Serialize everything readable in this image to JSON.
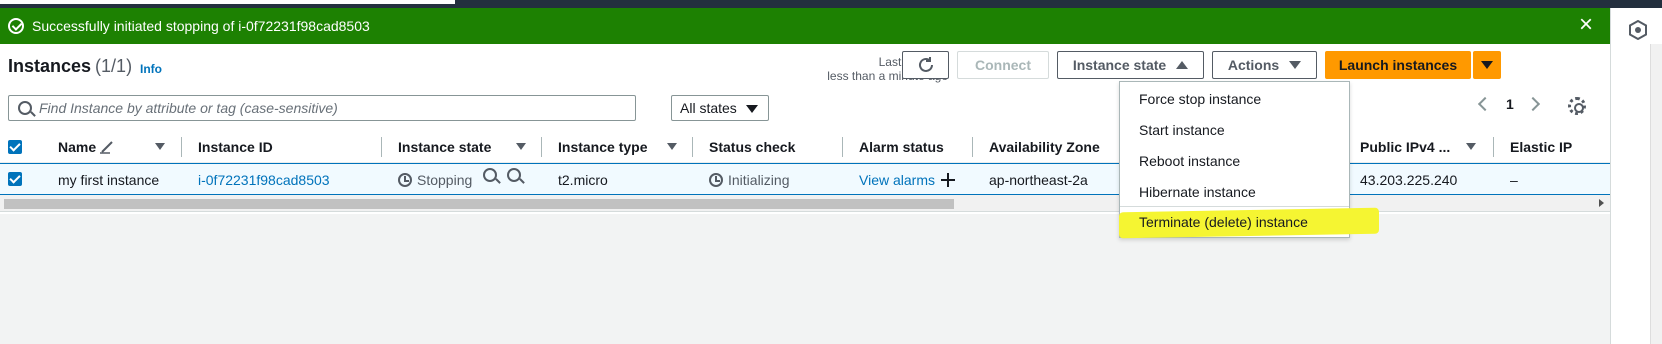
{
  "banner": {
    "message": "Successfully initiated stopping of i-0f72231f98cad8503",
    "close": "×"
  },
  "header": {
    "title": "Instances",
    "count": "(1/1)",
    "info": "Info",
    "last_updated_line1": "Last updated",
    "last_updated_line2": "less than a minute ago",
    "connect": "Connect",
    "instance_state": "Instance state",
    "actions": "Actions",
    "launch": "Launch instances"
  },
  "filter": {
    "placeholder": "Find Instance by attribute or tag (case-sensitive)",
    "states": "All states",
    "page": "1"
  },
  "columns": [
    "Name",
    "Instance ID",
    "Instance state",
    "Instance type",
    "Status check",
    "Alarm status",
    "Availability Zone",
    "Public IPv4 ...",
    "Elastic IP"
  ],
  "row": {
    "name": "my first instance",
    "instance_id": "i-0f72231f98cad8503",
    "state": "Stopping",
    "type": "t2.micro",
    "status": "Initializing",
    "alarm": "View alarms",
    "az": "ap-northeast-2a",
    "ipv4": "43.203.225.240",
    "elastic_ip": "–"
  },
  "menu": {
    "items": [
      "Force stop instance",
      "Start instance",
      "Reboot instance",
      "Hibernate instance",
      "Terminate (delete) instance"
    ]
  },
  "colors": {
    "success": "#1d8102",
    "primary": "#ff9900",
    "link": "#0073bb",
    "highlight": "#f5f532"
  }
}
